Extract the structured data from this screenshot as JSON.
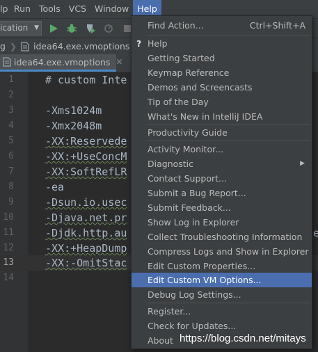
{
  "menubar": {
    "items": [
      {
        "label": "Help",
        "active": false
      },
      {
        "label": "Run",
        "active": false
      },
      {
        "label": "Tools",
        "active": false
      },
      {
        "label": "VCS",
        "active": false
      },
      {
        "label": "Window",
        "active": false
      },
      {
        "label": "Help",
        "active": true
      }
    ]
  },
  "toolbar": {
    "run_config": "ication",
    "icons": [
      "run-icon",
      "debug-icon",
      "coverage-icon",
      "profile-icon",
      "stop-icon"
    ]
  },
  "navbar": {
    "crumb_left": "g",
    "crumb_file": "idea64.exe.vmoptions"
  },
  "tab": {
    "label": "idea64.exe.vmoptions"
  },
  "editor": {
    "line_numbers": [
      "1",
      "2",
      "3",
      "4",
      "5",
      "6",
      "7",
      "8",
      "9",
      "10",
      "11",
      "12",
      "13",
      "14"
    ],
    "current_line": "13",
    "lines": [
      "# custom Inte",
      "",
      "-Xms1024m",
      "-Xmx2048m",
      "-XX:Reservede",
      "-XX:+UseConcM",
      "-XX:SoftRefLR",
      "-ea",
      "-Dsun.io.usec",
      "-Djava.net.pr",
      "-Djdk.http.au",
      "-XX:+HeapDump",
      "-XX:-OmitStac",
      ""
    ],
    "overflow_char": "e"
  },
  "help_menu": {
    "find_action": "Find Action...",
    "find_action_shortcut": "Ctrl+Shift+A",
    "help": "Help",
    "help_icon": "?",
    "getting_started": "Getting Started",
    "keymap_reference": "Keymap Reference",
    "demos": "Demos and Screencasts",
    "tip": "Tip of the Day",
    "whats_new": "What's New in IntelliJ IDEA",
    "productivity": "Productivity Guide",
    "activity": "Activity Monitor...",
    "diagnostic": "Diagnostic",
    "contact": "Contact Support...",
    "bug": "Submit a Bug Report...",
    "feedback": "Submit Feedback...",
    "show_log": "Show Log in Explorer",
    "collect": "Collect Troubleshooting Information",
    "compress": "Compress Logs and Show in Explorer",
    "edit_props": "Edit Custom Properties...",
    "edit_vm": "Edit Custom VM Options...",
    "debug_log": "Debug Log Settings...",
    "register": "Register...",
    "updates": "Check for Updates...",
    "about": "About"
  },
  "watermark": "https://blog.csdn.net/mitays",
  "colors": {
    "accent": "#4b6eaf",
    "menu_bg": "#3c3f41",
    "editor_bg": "#2b2b2b"
  }
}
